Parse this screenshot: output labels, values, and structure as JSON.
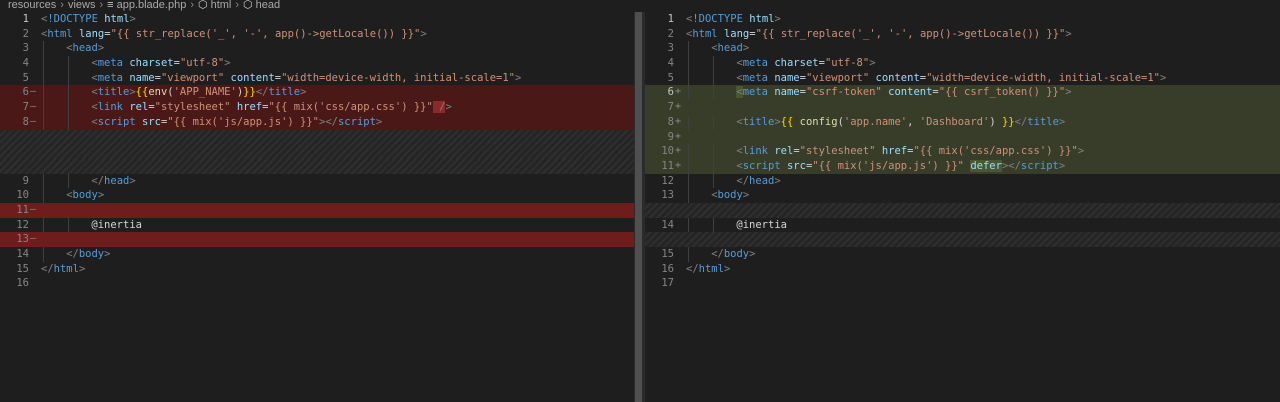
{
  "breadcrumb": {
    "items": [
      {
        "label": "resources",
        "icon": null
      },
      {
        "label": "views",
        "icon": null
      },
      {
        "label": "app.blade.php",
        "icon": "file-icon"
      },
      {
        "label": "html",
        "icon": "cube-icon"
      },
      {
        "label": "head",
        "icon": "cube-icon"
      }
    ]
  },
  "colors": {
    "background": "#1e1e1e",
    "deleted_line": "#4b1818",
    "inserted_line": "#373d29",
    "tag": "#569cd6",
    "attribute": "#9cdcfe",
    "string": "#ce9178"
  },
  "left": {
    "lines": [
      {
        "num": "1",
        "marker": "",
        "state": "",
        "indent": 0,
        "tokens": [
          [
            "punct",
            "<"
          ],
          [
            "tag",
            "!DOCTYPE"
          ],
          [
            "txt",
            " "
          ],
          [
            "attr",
            "html"
          ],
          [
            "punct",
            ">"
          ]
        ]
      },
      {
        "num": "2",
        "marker": "",
        "state": "",
        "indent": 0,
        "tokens": [
          [
            "punct",
            "<"
          ],
          [
            "tag",
            "html"
          ],
          [
            "txt",
            " "
          ],
          [
            "attr",
            "lang"
          ],
          [
            "txt",
            "="
          ],
          [
            "str",
            "\"{{ str_replace('_', '-', app()->getLocale()) }}\""
          ],
          [
            "punct",
            ">"
          ]
        ]
      },
      {
        "num": "3",
        "marker": "",
        "state": "",
        "indent": 1,
        "tokens": [
          [
            "punct",
            "<"
          ],
          [
            "tag",
            "head"
          ],
          [
            "punct",
            ">"
          ]
        ]
      },
      {
        "num": "4",
        "marker": "",
        "state": "",
        "indent": 2,
        "tokens": [
          [
            "punct",
            "<"
          ],
          [
            "tag",
            "meta"
          ],
          [
            "txt",
            " "
          ],
          [
            "attr",
            "charset"
          ],
          [
            "txt",
            "="
          ],
          [
            "str",
            "\"utf-8\""
          ],
          [
            "punct",
            ">"
          ]
        ]
      },
      {
        "num": "5",
        "marker": "",
        "state": "",
        "indent": 2,
        "tokens": [
          [
            "punct",
            "<"
          ],
          [
            "tag",
            "meta"
          ],
          [
            "txt",
            " "
          ],
          [
            "attr",
            "name"
          ],
          [
            "txt",
            "="
          ],
          [
            "str",
            "\"viewport\""
          ],
          [
            "txt",
            " "
          ],
          [
            "attr",
            "content"
          ],
          [
            "txt",
            "="
          ],
          [
            "str",
            "\"width=device-width, initial-scale=1\""
          ],
          [
            "punct",
            ">"
          ]
        ]
      },
      {
        "num": "6",
        "marker": "—",
        "state": "del",
        "indent": 2,
        "tokens": [
          [
            "punct",
            "<"
          ],
          [
            "tag",
            "title"
          ],
          [
            "punct",
            ">"
          ],
          [
            "brace",
            "{{"
          ],
          [
            "fn",
            "env"
          ],
          [
            "txt",
            "("
          ],
          [
            "str",
            "'APP_NAME'"
          ],
          [
            "txt",
            ")"
          ],
          [
            "brace",
            "}}"
          ],
          [
            "punct",
            "</"
          ],
          [
            "tag",
            "title"
          ],
          [
            "punct",
            ">"
          ]
        ]
      },
      {
        "num": "7",
        "marker": "—",
        "state": "del",
        "indent": 2,
        "tokens": [
          [
            "punct",
            "<"
          ],
          [
            "tag",
            "link"
          ],
          [
            "txt",
            " "
          ],
          [
            "attr",
            "rel"
          ],
          [
            "txt",
            "="
          ],
          [
            "str",
            "\"stylesheet\""
          ],
          [
            "txt",
            " "
          ],
          [
            "attr",
            "href"
          ],
          [
            "txt",
            "="
          ],
          [
            "str",
            "\"{{ mix('css/app.css') }}\""
          ],
          [
            "hl-del",
            " /"
          ],
          [
            "punct",
            ">"
          ]
        ]
      },
      {
        "num": "8",
        "marker": "—",
        "state": "del",
        "indent": 2,
        "tokens": [
          [
            "punct",
            "<"
          ],
          [
            "tag",
            "script"
          ],
          [
            "txt",
            " "
          ],
          [
            "attr",
            "src"
          ],
          [
            "txt",
            "="
          ],
          [
            "str",
            "\"{{ mix('js/app.js') }}\""
          ],
          [
            "punct",
            ">"
          ],
          [
            "punct",
            "</"
          ],
          [
            "tag",
            "script"
          ],
          [
            "punct",
            ">"
          ]
        ]
      },
      {
        "num": "",
        "marker": "",
        "state": "filler",
        "indent": 0,
        "tokens": []
      },
      {
        "num": "",
        "marker": "",
        "state": "filler",
        "indent": 0,
        "tokens": []
      },
      {
        "num": "",
        "marker": "",
        "state": "filler",
        "indent": 0,
        "tokens": []
      },
      {
        "num": "9",
        "marker": "",
        "state": "",
        "indent": 2,
        "tokens": [
          [
            "punct",
            "</"
          ],
          [
            "tag",
            "head"
          ],
          [
            "punct",
            ">"
          ]
        ]
      },
      {
        "num": "10",
        "marker": "",
        "state": "",
        "indent": 1,
        "tokens": [
          [
            "punct",
            "<"
          ],
          [
            "tag",
            "body"
          ],
          [
            "punct",
            ">"
          ]
        ]
      },
      {
        "num": "11",
        "marker": "—",
        "state": "del-strong",
        "indent": 0,
        "tokens": []
      },
      {
        "num": "12",
        "marker": "",
        "state": "",
        "indent": 2,
        "tokens": [
          [
            "txt",
            "@inertia"
          ]
        ]
      },
      {
        "num": "13",
        "marker": "—",
        "state": "del-strong",
        "indent": 0,
        "tokens": []
      },
      {
        "num": "14",
        "marker": "",
        "state": "",
        "indent": 1,
        "tokens": [
          [
            "punct",
            "</"
          ],
          [
            "tag",
            "body"
          ],
          [
            "punct",
            ">"
          ]
        ]
      },
      {
        "num": "15",
        "marker": "",
        "state": "",
        "indent": 0,
        "tokens": [
          [
            "punct",
            "</"
          ],
          [
            "tag",
            "html"
          ],
          [
            "punct",
            ">"
          ]
        ]
      },
      {
        "num": "16",
        "marker": "",
        "state": "",
        "indent": 0,
        "tokens": []
      }
    ]
  },
  "right": {
    "lines": [
      {
        "num": "1",
        "marker": "",
        "state": "",
        "indent": 0,
        "tokens": [
          [
            "punct",
            "<"
          ],
          [
            "tag",
            "!DOCTYPE"
          ],
          [
            "txt",
            " "
          ],
          [
            "attr",
            "html"
          ],
          [
            "punct",
            ">"
          ]
        ]
      },
      {
        "num": "2",
        "marker": "",
        "state": "",
        "indent": 0,
        "tokens": [
          [
            "punct",
            "<"
          ],
          [
            "tag",
            "html"
          ],
          [
            "txt",
            " "
          ],
          [
            "attr",
            "lang"
          ],
          [
            "txt",
            "="
          ],
          [
            "str",
            "\"{{ str_replace('_', '-', app()->getLocale()) }}\""
          ],
          [
            "punct",
            ">"
          ]
        ]
      },
      {
        "num": "3",
        "marker": "",
        "state": "",
        "indent": 1,
        "tokens": [
          [
            "punct",
            "<"
          ],
          [
            "tag",
            "head"
          ],
          [
            "punct",
            ">"
          ]
        ]
      },
      {
        "num": "4",
        "marker": "",
        "state": "",
        "indent": 2,
        "tokens": [
          [
            "punct",
            "<"
          ],
          [
            "tag",
            "meta"
          ],
          [
            "txt",
            " "
          ],
          [
            "attr",
            "charset"
          ],
          [
            "txt",
            "="
          ],
          [
            "str",
            "\"utf-8\""
          ],
          [
            "punct",
            ">"
          ]
        ]
      },
      {
        "num": "5",
        "marker": "",
        "state": "",
        "indent": 2,
        "tokens": [
          [
            "punct",
            "<"
          ],
          [
            "tag",
            "meta"
          ],
          [
            "txt",
            " "
          ],
          [
            "attr",
            "name"
          ],
          [
            "txt",
            "="
          ],
          [
            "str",
            "\"viewport\""
          ],
          [
            "txt",
            " "
          ],
          [
            "attr",
            "content"
          ],
          [
            "txt",
            "="
          ],
          [
            "str",
            "\"width=device-width, initial-scale=1\""
          ],
          [
            "punct",
            ">"
          ]
        ]
      },
      {
        "num": "6",
        "marker": "+",
        "state": "ins",
        "indent": 2,
        "tokens": [
          [
            "hl-ins",
            "<"
          ],
          [
            "tag",
            "meta"
          ],
          [
            "txt",
            " "
          ],
          [
            "attr",
            "name"
          ],
          [
            "txt",
            "="
          ],
          [
            "str",
            "\"csrf-token\""
          ],
          [
            "txt",
            " "
          ],
          [
            "attr",
            "content"
          ],
          [
            "txt",
            "="
          ],
          [
            "str",
            "\"{{ csrf_token() }}\""
          ],
          [
            "punct",
            ">"
          ]
        ]
      },
      {
        "num": "7",
        "marker": "+",
        "state": "ins",
        "indent": 0,
        "tokens": []
      },
      {
        "num": "8",
        "marker": "+",
        "state": "ins",
        "indent": 2,
        "tokens": [
          [
            "punct",
            "<"
          ],
          [
            "tag",
            "title"
          ],
          [
            "punct",
            ">"
          ],
          [
            "brace",
            "{{"
          ],
          [
            "fn",
            " config"
          ],
          [
            "txt",
            "("
          ],
          [
            "str",
            "'app.name'"
          ],
          [
            "txt",
            ", "
          ],
          [
            "str",
            "'Dashboard'"
          ],
          [
            "txt",
            ") "
          ],
          [
            "brace",
            "}}"
          ],
          [
            "punct",
            "</"
          ],
          [
            "tag",
            "title"
          ],
          [
            "punct",
            ">"
          ]
        ]
      },
      {
        "num": "9",
        "marker": "+",
        "state": "ins",
        "indent": 0,
        "tokens": []
      },
      {
        "num": "10",
        "marker": "+",
        "state": "ins",
        "indent": 2,
        "tokens": [
          [
            "punct",
            "<"
          ],
          [
            "tag",
            "link"
          ],
          [
            "txt",
            " "
          ],
          [
            "attr",
            "rel"
          ],
          [
            "txt",
            "="
          ],
          [
            "str",
            "\"stylesheet\""
          ],
          [
            "txt",
            " "
          ],
          [
            "attr",
            "href"
          ],
          [
            "txt",
            "="
          ],
          [
            "str",
            "\"{{ mix('css/app.css') }}\""
          ],
          [
            "punct",
            ">"
          ]
        ]
      },
      {
        "num": "11",
        "marker": "+",
        "state": "ins",
        "indent": 2,
        "tokens": [
          [
            "punct",
            "<"
          ],
          [
            "tag",
            "script"
          ],
          [
            "txt",
            " "
          ],
          [
            "attr",
            "src"
          ],
          [
            "txt",
            "="
          ],
          [
            "str",
            "\"{{ mix('js/app.js') }}\""
          ],
          [
            "txt",
            " "
          ],
          [
            "hl-ins",
            "defer"
          ],
          [
            "punct",
            "></"
          ],
          [
            "tag",
            "script"
          ],
          [
            "punct",
            ">"
          ]
        ]
      },
      {
        "num": "12",
        "marker": "",
        "state": "",
        "indent": 2,
        "tokens": [
          [
            "punct",
            "</"
          ],
          [
            "tag",
            "head"
          ],
          [
            "punct",
            ">"
          ]
        ]
      },
      {
        "num": "13",
        "marker": "",
        "state": "",
        "indent": 1,
        "tokens": [
          [
            "punct",
            "<"
          ],
          [
            "tag",
            "body"
          ],
          [
            "punct",
            ">"
          ]
        ]
      },
      {
        "num": "",
        "marker": "",
        "state": "filler",
        "indent": 0,
        "tokens": []
      },
      {
        "num": "14",
        "marker": "",
        "state": "",
        "indent": 2,
        "tokens": [
          [
            "txt",
            "@inertia"
          ]
        ]
      },
      {
        "num": "",
        "marker": "",
        "state": "filler",
        "indent": 0,
        "tokens": []
      },
      {
        "num": "15",
        "marker": "",
        "state": "",
        "indent": 1,
        "tokens": [
          [
            "punct",
            "</"
          ],
          [
            "tag",
            "body"
          ],
          [
            "punct",
            ">"
          ]
        ]
      },
      {
        "num": "16",
        "marker": "",
        "state": "",
        "indent": 0,
        "tokens": [
          [
            "punct",
            "</"
          ],
          [
            "tag",
            "html"
          ],
          [
            "punct",
            ">"
          ]
        ]
      },
      {
        "num": "17",
        "marker": "",
        "state": "",
        "indent": 0,
        "tokens": []
      }
    ]
  }
}
